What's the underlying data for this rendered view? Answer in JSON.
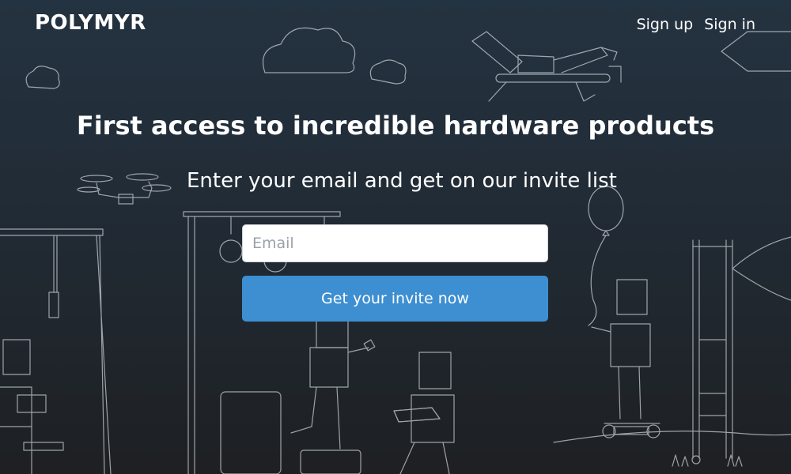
{
  "brand": {
    "logo_text": "POLYMYR"
  },
  "nav": {
    "sign_up": "Sign up",
    "sign_in": "Sign in"
  },
  "hero": {
    "headline": "First access to incredible hardware products",
    "subheadline": "Enter your email and get on our invite list"
  },
  "form": {
    "email_placeholder": "Email",
    "email_value": "",
    "submit_label": "Get your invite now"
  },
  "colors": {
    "background_top": "#243341",
    "background_bottom": "#1e2023",
    "line_art": "#c9ced3",
    "button": "#3d8fd1",
    "text": "#ffffff"
  },
  "illustrations": [
    "cloud-icon",
    "drone-icon",
    "balloon-icon",
    "hoverboard-icon",
    "swing-icon",
    "ladder-icon",
    "tablet-icon",
    "pen-tool-icon"
  ]
}
